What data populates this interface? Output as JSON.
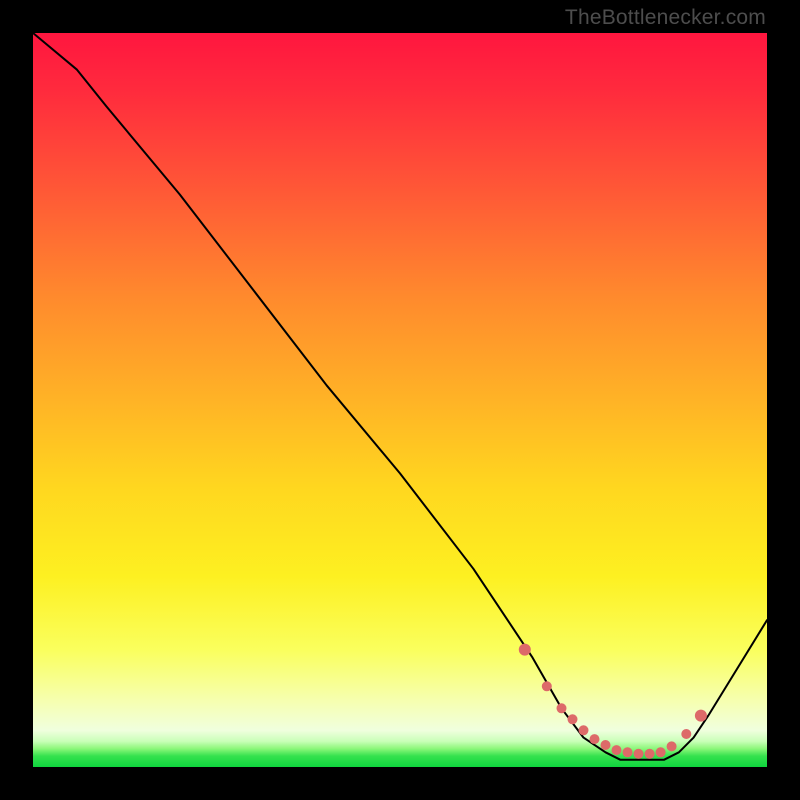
{
  "watermark": "TheBottlenecker.com",
  "colors": {
    "curve": "#000000",
    "dots": "#dd6a69",
    "background_top": "#ff163f",
    "background_bottom": "#0fd53e",
    "frame": "#000000"
  },
  "chart_data": {
    "type": "line",
    "title": "",
    "xlabel": "",
    "ylabel": "",
    "xlim": [
      0,
      100
    ],
    "ylim": [
      0,
      100
    ],
    "series": [
      {
        "name": "curve",
        "x": [
          0,
          6,
          10,
          20,
          30,
          40,
          50,
          60,
          68,
          72,
          75,
          78,
          80,
          83,
          86,
          88,
          90,
          92,
          100
        ],
        "y": [
          100,
          95,
          90,
          78,
          65,
          52,
          40,
          27,
          15,
          8,
          4,
          2,
          1,
          1,
          1,
          2,
          4,
          7,
          20
        ]
      }
    ],
    "markers": {
      "name": "highlight-dots",
      "x": [
        67,
        70,
        72,
        73.5,
        75,
        76.5,
        78,
        79.5,
        81,
        82.5,
        84,
        85.5,
        87,
        89,
        91
      ],
      "y": [
        16,
        11,
        8,
        6.5,
        5,
        3.8,
        3,
        2.3,
        2,
        1.8,
        1.8,
        2,
        2.8,
        4.5,
        7
      ]
    }
  }
}
